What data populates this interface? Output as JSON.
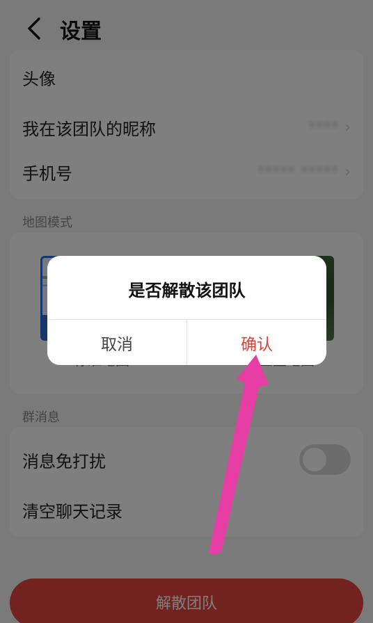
{
  "header": {
    "title": "设置"
  },
  "profile": {
    "avatar_label": "头像",
    "nickname_label": "我在该团队的昵称",
    "nickname_value": "****",
    "phone_label": "手机号",
    "phone_value": "***** *****"
  },
  "map_mode": {
    "section_label": "地图模式",
    "standard_label": "标准地图",
    "satellite_label": "卫星地图"
  },
  "group_messages": {
    "section_label": "群消息",
    "mute_label": "消息免打扰",
    "mute_enabled": false,
    "clear_label": "清空聊天记录"
  },
  "dissolve_button": {
    "label": "解散团队"
  },
  "dialog": {
    "title": "是否解散该团队",
    "cancel_label": "取消",
    "confirm_label": "确认"
  },
  "colors": {
    "accent_red": "#e5453f",
    "confirm_red": "#e0403a",
    "annotation_arrow": "#e63ea5"
  }
}
